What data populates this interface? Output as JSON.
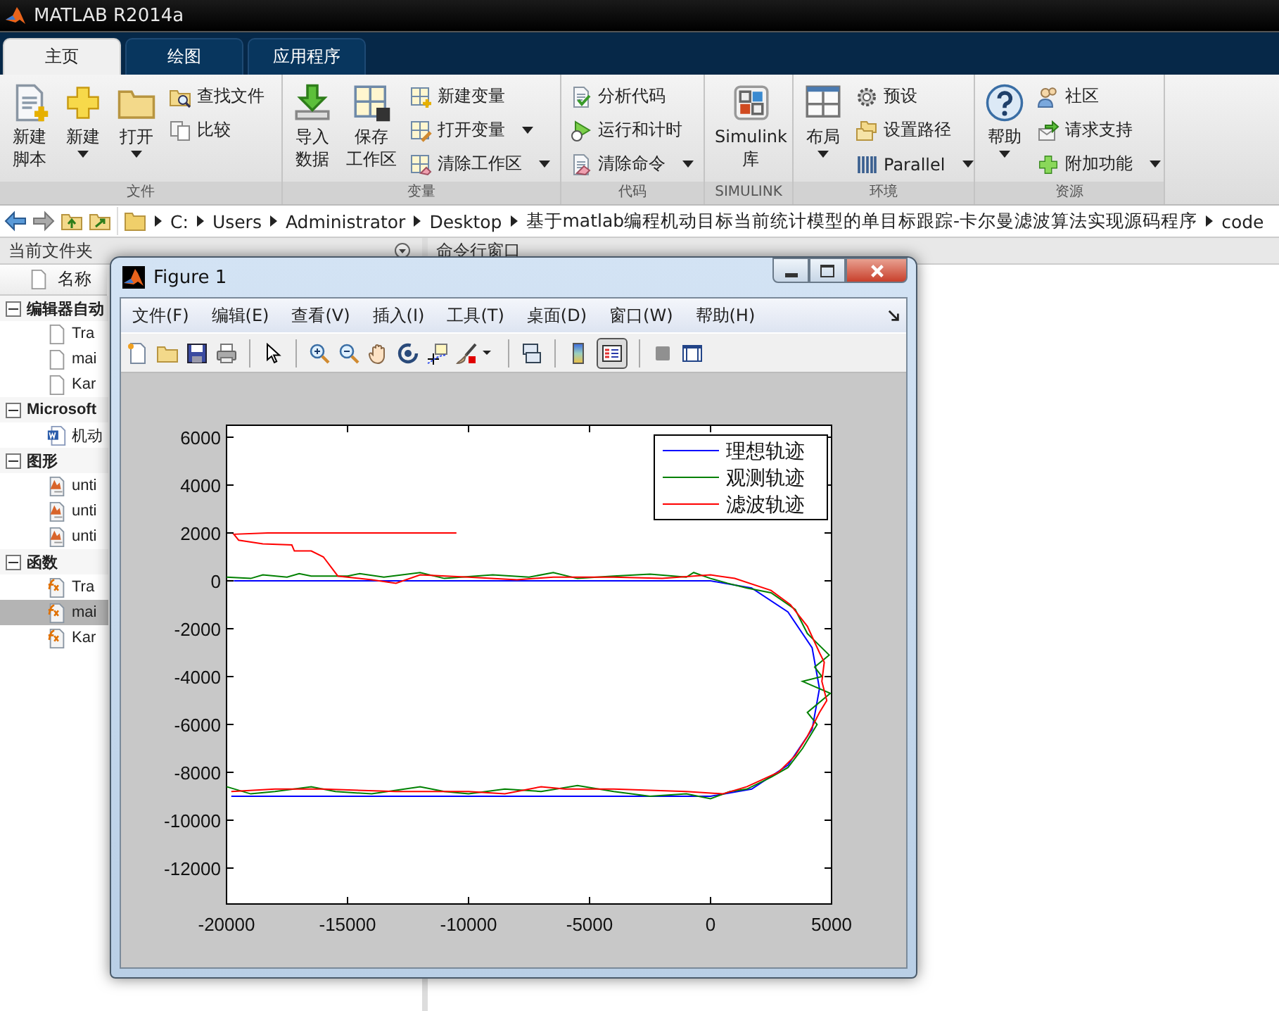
{
  "window": {
    "title": "MATLAB R2014a"
  },
  "tabs": [
    {
      "label": "主页",
      "selected": true
    },
    {
      "label": "绘图",
      "selected": false
    },
    {
      "label": "应用程序",
      "selected": false
    }
  ],
  "ribbon": {
    "groups": [
      {
        "label": "文件",
        "items": [
          {
            "lines": [
              "新建",
              "脚本"
            ],
            "kind": "large",
            "menu": false
          },
          {
            "lines": [
              "新建"
            ],
            "kind": "large",
            "menu": true
          },
          {
            "lines": [
              "打开"
            ],
            "kind": "large",
            "menu": true
          },
          {
            "label": "查找文件",
            "kind": "small",
            "menu": false
          },
          {
            "label": "比较",
            "kind": "small",
            "menu": false
          }
        ]
      },
      {
        "label": "变量",
        "items": [
          {
            "lines": [
              "导入",
              "数据"
            ],
            "kind": "large",
            "menu": false
          },
          {
            "lines": [
              "保存",
              "工作区"
            ],
            "kind": "large",
            "menu": false
          },
          {
            "label": "新建变量",
            "kind": "small",
            "menu": false
          },
          {
            "label": "打开变量",
            "kind": "small",
            "menu": true
          },
          {
            "label": "清除工作区",
            "kind": "small",
            "menu": true
          }
        ]
      },
      {
        "label": "代码",
        "items": [
          {
            "label": "分析代码",
            "kind": "small",
            "menu": false
          },
          {
            "label": "运行和计时",
            "kind": "small",
            "menu": false
          },
          {
            "label": "清除命令",
            "kind": "small",
            "menu": true
          }
        ]
      },
      {
        "label": "SIMULINK",
        "items": [
          {
            "lines": [
              "Simulink",
              "库"
            ],
            "kind": "large",
            "menu": false
          }
        ]
      },
      {
        "label": "环境",
        "items": [
          {
            "lines": [
              "布局"
            ],
            "kind": "large",
            "menu": true
          },
          {
            "label": "预设",
            "kind": "small",
            "menu": false
          },
          {
            "label": "设置路径",
            "kind": "small",
            "menu": false
          },
          {
            "label": "Parallel",
            "kind": "small",
            "menu": true
          }
        ]
      },
      {
        "label": "资源",
        "items": [
          {
            "lines": [
              "帮助"
            ],
            "kind": "large",
            "menu": true
          },
          {
            "label": "社区",
            "kind": "small",
            "menu": false
          },
          {
            "label": "请求支持",
            "kind": "small",
            "menu": false
          },
          {
            "label": "附加功能",
            "kind": "small",
            "menu": true
          }
        ]
      }
    ]
  },
  "path_bar": {
    "crumbs": [
      "C:",
      "Users",
      "Administrator",
      "Desktop",
      "基于matlab编程机动目标当前统计模型的单目标跟踪-卡尔曼滤波算法实现源码程序",
      "code"
    ]
  },
  "file_browser": {
    "title": "当前文件夹",
    "column_header": "名称",
    "groups": [
      {
        "name": "编辑器自动",
        "expanded": true,
        "children": [
          {
            "name": "Tra",
            "selected": false
          },
          {
            "name": "mai",
            "selected": false
          },
          {
            "name": "Kar",
            "selected": false
          }
        ]
      },
      {
        "name": "Microsoft",
        "expanded": true,
        "children": [
          {
            "name": "机动",
            "selected": false
          }
        ]
      },
      {
        "name": "图形",
        "expanded": true,
        "children": [
          {
            "name": "unti",
            "selected": false
          },
          {
            "name": "unti",
            "selected": false
          },
          {
            "name": "unti",
            "selected": false
          }
        ]
      },
      {
        "name": "函数",
        "expanded": true,
        "children": [
          {
            "name": "Tra",
            "selected": false
          },
          {
            "name": "mai",
            "selected": true
          },
          {
            "name": "Kar",
            "selected": false
          }
        ]
      }
    ]
  },
  "command_window": {
    "title": "命令行窗口"
  },
  "figure": {
    "title": "Figure 1",
    "menu": [
      "文件(F)",
      "编辑(E)",
      "查看(V)",
      "插入(I)",
      "工具(T)",
      "桌面(D)",
      "窗口(W)",
      "帮助(H)"
    ],
    "legend_tool_on": true,
    "chart_data": {
      "type": "line",
      "legend": true,
      "xlim": [
        -20000,
        5000
      ],
      "ylim": [
        -13500,
        6500
      ],
      "xticks": [
        -20000,
        -15000,
        -10000,
        -5000,
        0,
        5000
      ],
      "yticks": [
        -12000,
        -10000,
        -8000,
        -6000,
        -4000,
        -2000,
        0,
        2000,
        4000,
        6000
      ],
      "series": [
        {
          "name": "理想轨迹",
          "color": "#0000ff",
          "x": [
            -19700,
            0,
            1700,
            3200,
            4200,
            4500,
            4200,
            3200,
            1700,
            0,
            -19800
          ],
          "values": [
            0,
            0,
            -300,
            -1300,
            -2800,
            -4500,
            -6200,
            -7700,
            -8700,
            -9000,
            -9000
          ]
        },
        {
          "name": "观测轨迹",
          "color": "#008000",
          "x": [
            -20000,
            -19000,
            -18500,
            -17500,
            -17000,
            -16500,
            -15000,
            -14500,
            -13500,
            -12000,
            -11000,
            -9000,
            -7500,
            -6500,
            -5500,
            -4000,
            -2500,
            -1000,
            -700,
            0,
            700,
            1500,
            2500,
            3500,
            4000,
            4200,
            4900,
            4300,
            4600,
            3800,
            4950,
            4000,
            4400,
            3800,
            3200,
            2500,
            1500,
            800,
            0,
            -1000,
            -2500,
            -4000,
            -5500,
            -7000,
            -8500,
            -10000,
            -11000,
            -12000,
            -14000,
            -15500,
            -16500,
            -18000,
            -19000,
            -20000
          ],
          "values": [
            150,
            100,
            250,
            150,
            300,
            200,
            200,
            300,
            150,
            350,
            100,
            250,
            150,
            350,
            100,
            200,
            280,
            150,
            350,
            100,
            -100,
            -300,
            -500,
            -1200,
            -2200,
            -2400,
            -3100,
            -3600,
            -4000,
            -4200,
            -4700,
            -5500,
            -6000,
            -7000,
            -7800,
            -8200,
            -8700,
            -8800,
            -9100,
            -8900,
            -9000,
            -8800,
            -8550,
            -8800,
            -8700,
            -8900,
            -8800,
            -8600,
            -8900,
            -8800,
            -8600,
            -8800,
            -8900,
            -8600
          ]
        },
        {
          "name": "滤波轨迹",
          "color": "#ff0000",
          "x": [
            -10500,
            -18300,
            -19700,
            -19500,
            -18500,
            -17300,
            -17200,
            -16500,
            -16000,
            -15400,
            -14000,
            -13000,
            -12000,
            -10000,
            -8000,
            -6500,
            -4000,
            -2000,
            0,
            1000,
            2500,
            3300,
            4000,
            4500,
            4700,
            4600,
            4800,
            4500,
            4000,
            3500,
            2800,
            1500,
            500,
            -1000,
            -4000,
            -6000,
            -7000,
            -8500,
            -10000,
            -13000,
            -16000,
            -18000,
            -19800
          ],
          "values": [
            2000,
            2000,
            1950,
            1700,
            1550,
            1500,
            1250,
            1250,
            1000,
            200,
            50,
            -100,
            250,
            150,
            50,
            150,
            150,
            100,
            250,
            100,
            -400,
            -1000,
            -1900,
            -3000,
            -3400,
            -4200,
            -5000,
            -5500,
            -6500,
            -7300,
            -8000,
            -8600,
            -8900,
            -8800,
            -8700,
            -8700,
            -8600,
            -8900,
            -8800,
            -8800,
            -8700,
            -8700,
            -8800
          ]
        }
      ]
    }
  }
}
